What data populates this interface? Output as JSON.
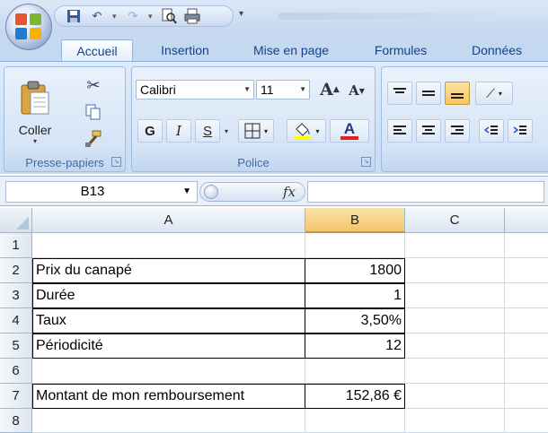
{
  "app": {
    "office_button": "office-button",
    "quick_access": [
      "save-icon",
      "undo-icon",
      "redo-icon",
      "print-preview-icon",
      "print-icon"
    ],
    "customize_arrow": "▾"
  },
  "tabs": [
    {
      "label": "Accueil",
      "active": true
    },
    {
      "label": "Insertion",
      "active": false
    },
    {
      "label": "Mise en page",
      "active": false
    },
    {
      "label": "Formules",
      "active": false
    },
    {
      "label": "Données",
      "active": false
    }
  ],
  "ribbon": {
    "clipboard": {
      "label": "Presse-papiers",
      "paste_label": "Coller"
    },
    "font": {
      "label": "Police",
      "font_name": "Calibri",
      "font_size": "11",
      "bold": "G",
      "italic": "I",
      "underline": "S",
      "grow": "A",
      "shrink": "A",
      "font_color_letter": "A"
    },
    "colors": {
      "accent": "#15428b",
      "fill_highlight": "#ffff00",
      "font_color": "#e02020",
      "selected_header": "#f4c56a"
    }
  },
  "formula_bar": {
    "name_box": "B13",
    "fx": "fx",
    "content": ""
  },
  "sheet": {
    "columns": [
      "A",
      "B",
      "C"
    ],
    "selected_column": "B",
    "rows": [
      {
        "n": "1",
        "a": "",
        "b": ""
      },
      {
        "n": "2",
        "a": "Prix du canapé",
        "b": "1800"
      },
      {
        "n": "3",
        "a": "Durée",
        "b": "1"
      },
      {
        "n": "4",
        "a": "Taux",
        "b": "3,50%"
      },
      {
        "n": "5",
        "a": "Périodicité",
        "b": "12"
      },
      {
        "n": "6",
        "a": "",
        "b": ""
      },
      {
        "n": "7",
        "a": "Montant de mon remboursement",
        "b": "152,86 €"
      },
      {
        "n": "8",
        "a": "",
        "b": ""
      }
    ]
  }
}
